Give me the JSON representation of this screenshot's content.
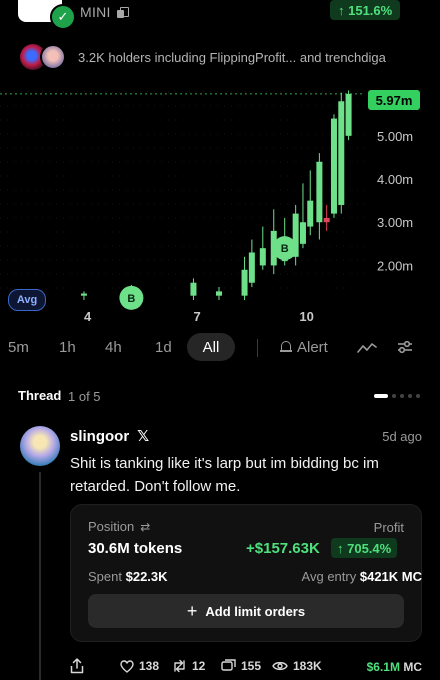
{
  "header": {
    "ticker": "MINI",
    "change_badge": "↑ 151.6%",
    "colors": {
      "accent_green": "#34d05f",
      "badge_bg": "#0f3a1e",
      "background": "#000000"
    }
  },
  "holders": {
    "text": "3.2K holders including FlippingProfit... and trenchdiga"
  },
  "chart": {
    "current_price_label": "5.97m",
    "avg_button": "Avg",
    "marker_label": "B"
  },
  "chart_data": {
    "type": "candlestick",
    "y_axis_ticks": [
      "5.00m",
      "4.00m",
      "3.00m",
      "2.00m"
    ],
    "y_tick_values": [
      5.0,
      4.0,
      3.0,
      2.0
    ],
    "x_axis_ticks": [
      "4",
      "7",
      "10"
    ],
    "x_tick_values": [
      4,
      7,
      10
    ],
    "xlim": [
      1.6,
      11.6
    ],
    "ylim": [
      1.2,
      6.2
    ],
    "current_price": 5.97,
    "buy_markers": [
      {
        "x": 5.2,
        "y": 1.25,
        "label": "B"
      },
      {
        "x": 9.4,
        "y": 2.4,
        "label": "B"
      }
    ],
    "candles": [
      {
        "x": 3.9,
        "o": 1.3,
        "h": 1.4,
        "l": 1.2,
        "c": 1.35,
        "up": true
      },
      {
        "x": 5.2,
        "o": 1.3,
        "h": 1.55,
        "l": 1.25,
        "c": 1.4,
        "up": true
      },
      {
        "x": 6.9,
        "o": 1.3,
        "h": 1.7,
        "l": 1.2,
        "c": 1.6,
        "up": true
      },
      {
        "x": 7.6,
        "o": 1.3,
        "h": 1.5,
        "l": 1.2,
        "c": 1.4,
        "up": true
      },
      {
        "x": 8.3,
        "o": 1.3,
        "h": 2.2,
        "l": 1.2,
        "c": 1.9,
        "up": true
      },
      {
        "x": 8.5,
        "o": 1.6,
        "h": 2.6,
        "l": 1.5,
        "c": 2.3,
        "up": true
      },
      {
        "x": 8.8,
        "o": 2.0,
        "h": 2.9,
        "l": 1.9,
        "c": 2.4,
        "up": true
      },
      {
        "x": 9.1,
        "o": 2.0,
        "h": 3.3,
        "l": 1.8,
        "c": 2.8,
        "up": true
      },
      {
        "x": 9.4,
        "o": 2.1,
        "h": 3.1,
        "l": 2.0,
        "c": 2.3,
        "up": true
      },
      {
        "x": 9.7,
        "o": 2.2,
        "h": 3.4,
        "l": 2.0,
        "c": 3.2,
        "up": true
      },
      {
        "x": 9.9,
        "o": 2.5,
        "h": 3.9,
        "l": 2.4,
        "c": 3.0,
        "up": true
      },
      {
        "x": 10.1,
        "o": 2.9,
        "h": 4.2,
        "l": 2.7,
        "c": 3.5,
        "up": true
      },
      {
        "x": 10.35,
        "o": 3.0,
        "h": 4.6,
        "l": 2.6,
        "c": 4.4,
        "up": true
      },
      {
        "x": 10.55,
        "o": 3.1,
        "h": 3.4,
        "l": 2.8,
        "c": 3.0,
        "up": false
      },
      {
        "x": 10.75,
        "o": 3.2,
        "h": 5.5,
        "l": 3.1,
        "c": 5.4,
        "up": true
      },
      {
        "x": 10.95,
        "o": 3.4,
        "h": 6.0,
        "l": 3.2,
        "c": 5.8,
        "up": true
      },
      {
        "x": 11.15,
        "o": 5.0,
        "h": 6.05,
        "l": 4.9,
        "c": 5.97,
        "up": true
      }
    ]
  },
  "timeframes": {
    "items": [
      "5m",
      "1h",
      "4h",
      "1d"
    ],
    "active": "All",
    "alert": "Alert"
  },
  "thread": {
    "title": "Thread",
    "count": "1 of 5"
  },
  "post": {
    "username": "slingoor",
    "x_glyph": "𝕏",
    "time": "5d ago",
    "text": "Shit is tanking like it's larp but im bidding bc im retarded. Don't follow me."
  },
  "position": {
    "label": "Position",
    "profit_label": "Profit",
    "tokens": "30.6M tokens",
    "profit_value": "+$157.63K",
    "profit_pct": "↑ 705.4%",
    "spent_label": "Spent",
    "spent_value": "$22.3K",
    "avg_entry_label": "Avg entry",
    "avg_entry_value": "$421K MC",
    "limit_button": "Add limit orders"
  },
  "actions": {
    "likes": "138",
    "reposts": "12",
    "comments": "155",
    "views": "183K",
    "mc_value": "$6.1M",
    "mc_unit": "MC"
  }
}
